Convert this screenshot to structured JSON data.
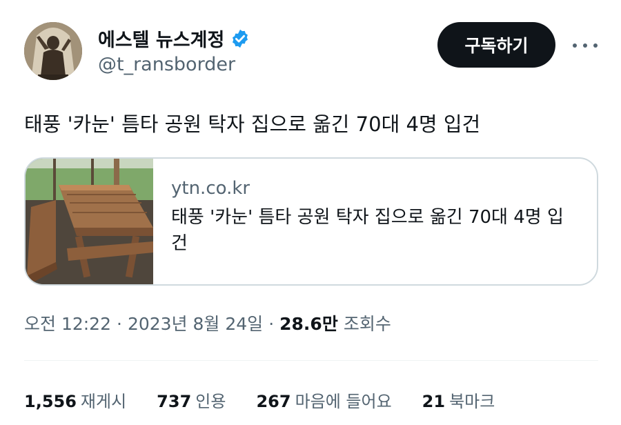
{
  "user": {
    "display_name": "에스텔 뉴스계정",
    "handle": "@t_ransborder",
    "verified_icon": "verified-badge-icon",
    "avatar": "statue-avatar"
  },
  "actions": {
    "follow_label": "구독하기",
    "more_icon": "more-options-icon"
  },
  "tweet": {
    "text": "태풍 '카눈' 틈타 공원 탁자 집으로 옮긴 70대 4명 입건"
  },
  "link_card": {
    "domain": "ytn.co.kr",
    "title": "태풍 '카눈' 틈타 공원 탁자 집으로 옮긴 70대 4명 입건",
    "thumbnail": "picnic-table-photo"
  },
  "meta": {
    "time": "오전 12:22",
    "date": "2023년 8월 24일",
    "separator": "·",
    "views_count": "28.6만",
    "views_label": "조회수"
  },
  "stats": [
    {
      "count": "1,556",
      "label": "재게시"
    },
    {
      "count": "737",
      "label": "인용"
    },
    {
      "count": "267",
      "label": "마음에 들어요"
    },
    {
      "count": "21",
      "label": "북마크"
    }
  ],
  "colors": {
    "verified_blue": "#1d9bf0",
    "text_primary": "#0f1419",
    "text_secondary": "#536471",
    "button_bg": "#0f1419",
    "border": "#cfd9de"
  }
}
